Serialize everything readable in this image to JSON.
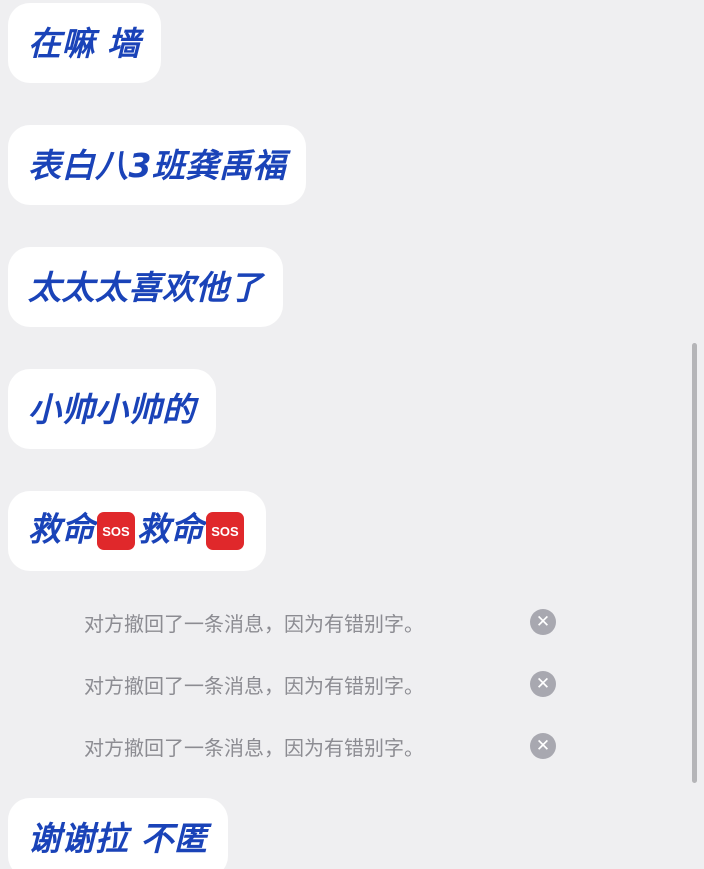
{
  "messages": [
    {
      "text": "在嘛 墙"
    },
    {
      "text": "表白八3班龚禹福"
    },
    {
      "text": "太太太喜欢他了"
    },
    {
      "text": "小帅小帅的"
    },
    {
      "parts": [
        "救命",
        "🆘",
        "救命",
        "🆘"
      ],
      "sos_label": "SOS"
    },
    {
      "text": "谢谢拉 不匿"
    }
  ],
  "recall_notices": [
    {
      "text": "对方撤回了一条消息，因为有错别字。",
      "icon": "close-circle-icon"
    },
    {
      "text": "对方撤回了一条消息，因为有错别字。",
      "icon": "close-circle-icon"
    },
    {
      "text": "对方撤回了一条消息，因为有错别字。",
      "icon": "close-circle-icon"
    }
  ],
  "colors": {
    "background": "#efeff1",
    "bubble": "#ffffff",
    "message_text": "#1a43b8",
    "notice_text": "#8c8c92",
    "sos_badge": "#e0282b"
  }
}
